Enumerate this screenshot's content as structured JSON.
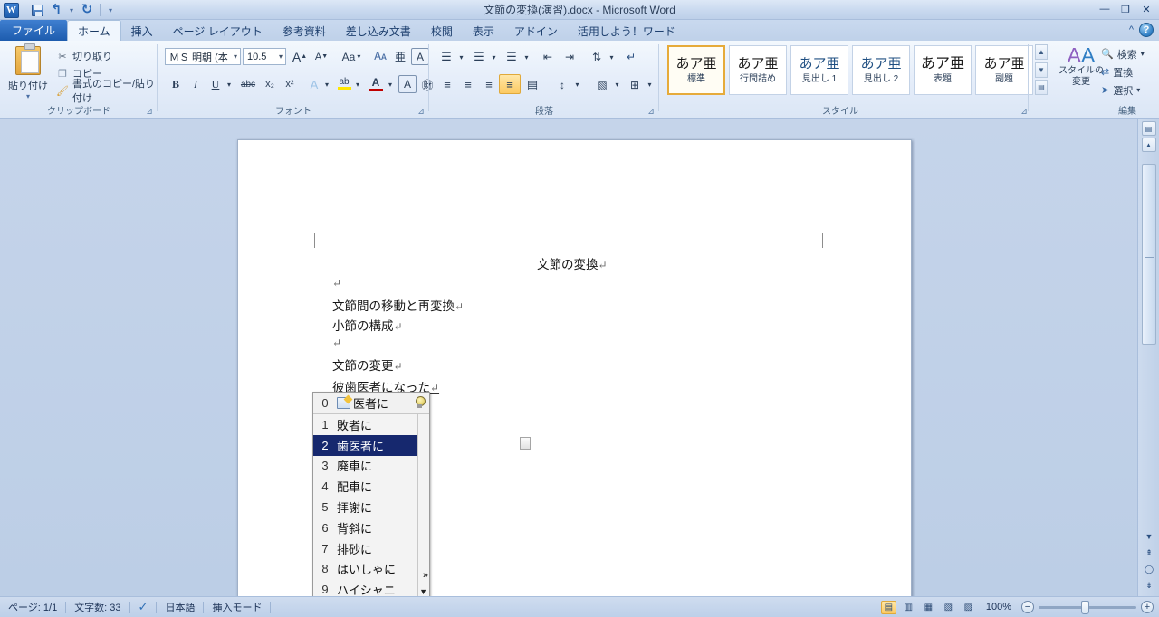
{
  "window": {
    "title": "文節の変換(演習).docx  -  Microsoft Word",
    "minimize": "—",
    "restore": "❐",
    "close": "✕",
    "ribbon_collapse": "^",
    "help": "?"
  },
  "quick_access": {
    "logo": "W",
    "save_tip": "save-icon",
    "undo": "↰",
    "undo_more": "▾",
    "redo": "↻",
    "customize": "▾"
  },
  "tabs": [
    {
      "label": "ファイル",
      "kind": "file"
    },
    {
      "label": "ホーム",
      "kind": "active"
    },
    {
      "label": "挿入",
      "kind": "normal"
    },
    {
      "label": "ページ レイアウト",
      "kind": "normal"
    },
    {
      "label": "参考資料",
      "kind": "normal"
    },
    {
      "label": "差し込み文書",
      "kind": "normal"
    },
    {
      "label": "校閲",
      "kind": "normal"
    },
    {
      "label": "表示",
      "kind": "normal"
    },
    {
      "label": "アドイン",
      "kind": "normal"
    },
    {
      "label": "活用しよう！ワード",
      "kind": "normal"
    }
  ],
  "ribbon": {
    "clipboard": {
      "group_label": "クリップボード",
      "paste_label": "貼り付け",
      "paste_arrow": "▾",
      "cut_label": "切り取り",
      "copy_label": "コピー",
      "format_painter_label": "書式のコピー/貼り付け"
    },
    "font": {
      "group_label": "フォント",
      "font_name": "ＭＳ 明朝 (本",
      "font_size": "10.5",
      "grow_font": "A",
      "shrink_font": "A",
      "change_case": "Aa",
      "clear_formatting": "A",
      "bold": "B",
      "italic": "I",
      "underline": "U",
      "strikethrough": "abc",
      "subscript": "x₂",
      "superscript": "x²",
      "text_effects": "A",
      "highlight": "ab",
      "font_color": "A",
      "phonetic_guide": "亜",
      "character_border": "A",
      "enclose_characters": "字"
    },
    "paragraph": {
      "group_label": "段落",
      "bullets": "≔",
      "numbering": "≕",
      "multilevel": "≖",
      "decrease_indent": "⇤",
      "increase_indent": "⇥",
      "sort": "A↓",
      "show_marks": "¶",
      "align_left": "≡",
      "align_center": "≡",
      "align_right": "≡",
      "justify": "≡",
      "distribute": "≣",
      "line_spacing": "↕",
      "shading": "▧",
      "borders": "⊞"
    },
    "styles": {
      "group_label": "スタイル",
      "items": [
        {
          "sample": "あア亜",
          "name": "標準",
          "mark": "↵",
          "selected": true
        },
        {
          "sample": "あア亜",
          "name": "行間詰め",
          "mark": "↵",
          "selected": false
        },
        {
          "sample": "あア亜",
          "name": "見出し 1",
          "mark": "",
          "selected": false
        },
        {
          "sample": "あア亜",
          "name": "見出し 2",
          "mark": "",
          "selected": false
        },
        {
          "sample": "あア亜",
          "name": "表題",
          "mark": "",
          "selected": false
        },
        {
          "sample": "あア亜",
          "name": "副題",
          "mark": "",
          "selected": false
        }
      ],
      "change_styles_line1": "スタイルの",
      "change_styles_line2": "変更",
      "change_styles_arrow": "▾",
      "scroll_up": "▲",
      "scroll_down": "▼",
      "scroll_more": "▤"
    },
    "editing": {
      "group_label": "編集",
      "find": "検索",
      "replace": "置換",
      "select": "選択",
      "arrow": "▾"
    }
  },
  "document": {
    "title_line": "文節の変換",
    "lines": [
      {
        "text": "",
        "mark": "↵"
      },
      {
        "text": "文節間の移動と再変換",
        "mark": "↵"
      },
      {
        "text": "小節の構成",
        "mark": "↵"
      },
      {
        "text": "",
        "mark": "↵"
      },
      {
        "text": "文節の変更",
        "mark": "↵"
      },
      {
        "text": "彼歯医者になった",
        "mark": "↵"
      }
    ]
  },
  "ime": {
    "header": {
      "index": "0",
      "text": "医者に"
    },
    "candidates": [
      {
        "index": "1",
        "text": "敗者に",
        "selected": false
      },
      {
        "index": "2",
        "text": "歯医者に",
        "selected": true
      },
      {
        "index": "3",
        "text": "廃車に",
        "selected": false
      },
      {
        "index": "4",
        "text": "配車に",
        "selected": false
      },
      {
        "index": "5",
        "text": "拝謝に",
        "selected": false
      },
      {
        "index": "6",
        "text": "背斜に",
        "selected": false
      },
      {
        "index": "7",
        "text": "排砂に",
        "selected": false
      },
      {
        "index": "8",
        "text": "はいしゃに",
        "selected": false
      },
      {
        "index": "9",
        "text": "ハイシャニ",
        "selected": false
      }
    ],
    "expand": "»",
    "scroll_down": "▼",
    "highlight_color": "#16286e"
  },
  "status_bar": {
    "page": "ページ: 1/1",
    "word_count": "文字数: 33",
    "proofing_icon": "spell-check-icon",
    "language": "日本語",
    "insert_mode": "挿入モード",
    "views": [
      {
        "name": "print-layout",
        "glyph": "▤",
        "selected": true
      },
      {
        "name": "full-screen-reading",
        "glyph": "▥",
        "selected": false
      },
      {
        "name": "web-layout",
        "glyph": "▦",
        "selected": false
      },
      {
        "name": "outline",
        "glyph": "▧",
        "selected": false
      },
      {
        "name": "draft",
        "glyph": "▨",
        "selected": false
      }
    ],
    "zoom_level": "100%",
    "zoom_out": "−",
    "zoom_in": "+"
  }
}
